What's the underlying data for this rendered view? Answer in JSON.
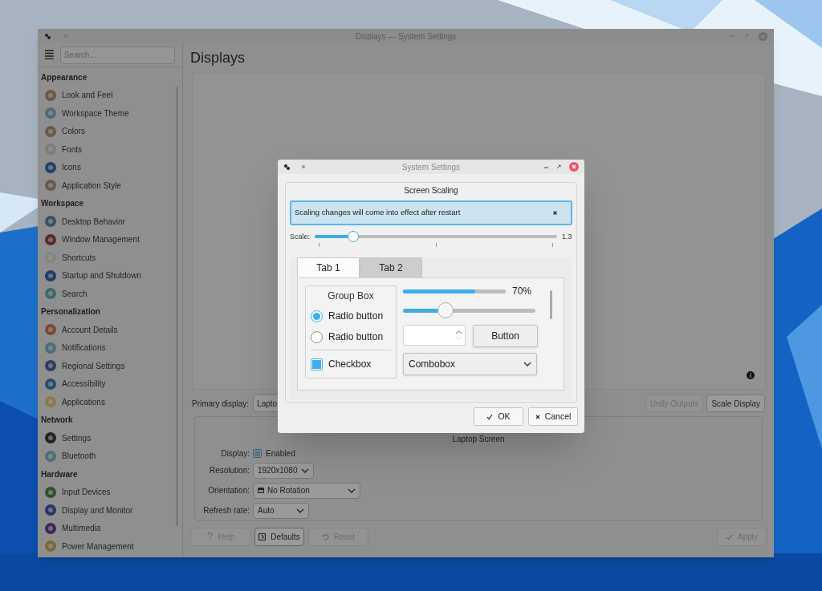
{
  "window": {
    "title": "Displays — System Settings"
  },
  "sidebar": {
    "search_placeholder": "Search...",
    "sections": [
      {
        "title": "Appearance",
        "items": [
          {
            "label": "Look and Feel"
          },
          {
            "label": "Workspace Theme"
          },
          {
            "label": "Colors"
          },
          {
            "label": "Fonts"
          },
          {
            "label": "Icons"
          },
          {
            "label": "Application Style"
          }
        ]
      },
      {
        "title": "Workspace",
        "items": [
          {
            "label": "Desktop Behavior"
          },
          {
            "label": "Window Management"
          },
          {
            "label": "Shortcuts"
          },
          {
            "label": "Startup and Shutdown"
          },
          {
            "label": "Search"
          }
        ]
      },
      {
        "title": "Personalization",
        "items": [
          {
            "label": "Account Details"
          },
          {
            "label": "Notifications"
          },
          {
            "label": "Regional Settings"
          },
          {
            "label": "Accessibility"
          },
          {
            "label": "Applications"
          }
        ]
      },
      {
        "title": "Network",
        "items": [
          {
            "label": "Settings"
          },
          {
            "label": "Bluetooth"
          }
        ]
      },
      {
        "title": "Hardware",
        "items": [
          {
            "label": "Input Devices"
          },
          {
            "label": "Display and Monitor"
          },
          {
            "label": "Multimedia"
          },
          {
            "label": "Power Management"
          }
        ]
      }
    ]
  },
  "page_title": "Displays",
  "primary_display": {
    "label": "Primary display:",
    "value": "Lapto"
  },
  "output_buttons": [
    {
      "label": "Unify Outputs",
      "disabled": true
    },
    {
      "label": "Scale Display",
      "disabled": false
    }
  ],
  "output_group": {
    "title": "Laptop Screen",
    "fields": [
      {
        "label": "Display:",
        "kind": "checkbox",
        "value": "Enabled",
        "checked": true
      },
      {
        "label": "Resolution:",
        "kind": "combo",
        "value": "1920x1080"
      },
      {
        "label": "Orientation:",
        "kind": "icon_combo",
        "value": "No Rotation"
      },
      {
        "label": "Refresh rate:",
        "kind": "combo",
        "value": "Auto"
      }
    ]
  },
  "footer_buttons": [
    {
      "label": "Help",
      "kind": "help",
      "disabled": true
    },
    {
      "label": "Defaults",
      "kind": "defaults",
      "disabled": false
    },
    {
      "label": "Reset",
      "kind": "reset",
      "disabled": true
    },
    {
      "label": "Apply",
      "kind": "apply",
      "disabled": true
    }
  ],
  "dialog": {
    "title": "System Settings",
    "group_title": "Screen Scaling",
    "message": "Scaling changes will come into effect after restart",
    "scale": {
      "label": "Scale:",
      "level": 0.16,
      "reading": "1.3"
    },
    "tabs": [
      {
        "label": "Tab 1",
        "selected": true
      },
      {
        "label": "Tab 2",
        "selected": false
      }
    ],
    "group_box": {
      "title": "Group Box",
      "radios": [
        {
          "label": "Radio button",
          "selected": true
        },
        {
          "label": "Radio button",
          "selected": false
        }
      ],
      "checkbox": {
        "label": "Checkbox",
        "checked": true
      }
    },
    "progress": {
      "level": 0.7,
      "reading": "70%"
    },
    "slider": {
      "level": 0.32
    },
    "button": "Button",
    "combobox": "Combobox",
    "buttons": [
      {
        "label": "OK",
        "kind": "ok"
      },
      {
        "label": "Cancel",
        "kind": "cancel"
      }
    ]
  }
}
